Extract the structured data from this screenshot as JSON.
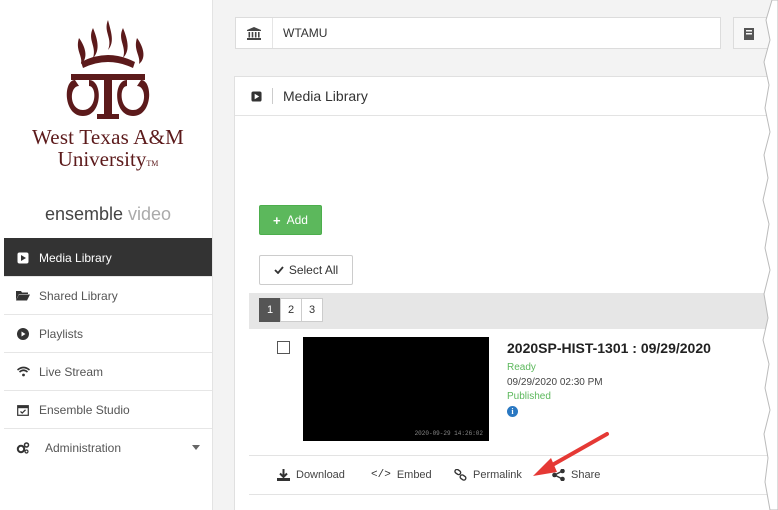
{
  "university": {
    "name_line1": "West Texas A&M",
    "name_line2": "University",
    "tm": "TM",
    "brand_main": "ensemble",
    "brand_accent": "video"
  },
  "colors": {
    "maroon": "#5c1a1b",
    "sidebar_active": "#333333",
    "green": "#5cb85c",
    "info_blue": "#2a78c2",
    "arrow_red": "#e53935"
  },
  "sidebar": {
    "items": [
      {
        "label": "Media Library",
        "icon": "play-square-icon"
      },
      {
        "label": "Shared Library",
        "icon": "folder-open-icon"
      },
      {
        "label": "Playlists",
        "icon": "circle-play-icon"
      },
      {
        "label": "Live Stream",
        "icon": "wifi-icon"
      },
      {
        "label": "Ensemble Studio",
        "icon": "calendar-check-icon"
      },
      {
        "label": "Administration",
        "icon": "cogs-icon"
      }
    ]
  },
  "topbar": {
    "org": "WTAMU"
  },
  "panel": {
    "title": "Media Library"
  },
  "buttons": {
    "add": "Add",
    "select_all": "Select All"
  },
  "pagination": {
    "pages": [
      "1",
      "2",
      "3"
    ]
  },
  "media": {
    "thumb_timestamp": "2020-09-29 14:26:02",
    "title": "2020SP-HIST-1301 : 09/29/2020",
    "status": "Ready",
    "date": "09/29/2020 02:30 PM",
    "published": "Published"
  },
  "actions": {
    "download": "Download",
    "embed": "Embed",
    "permalink": "Permalink",
    "share": "Share"
  }
}
